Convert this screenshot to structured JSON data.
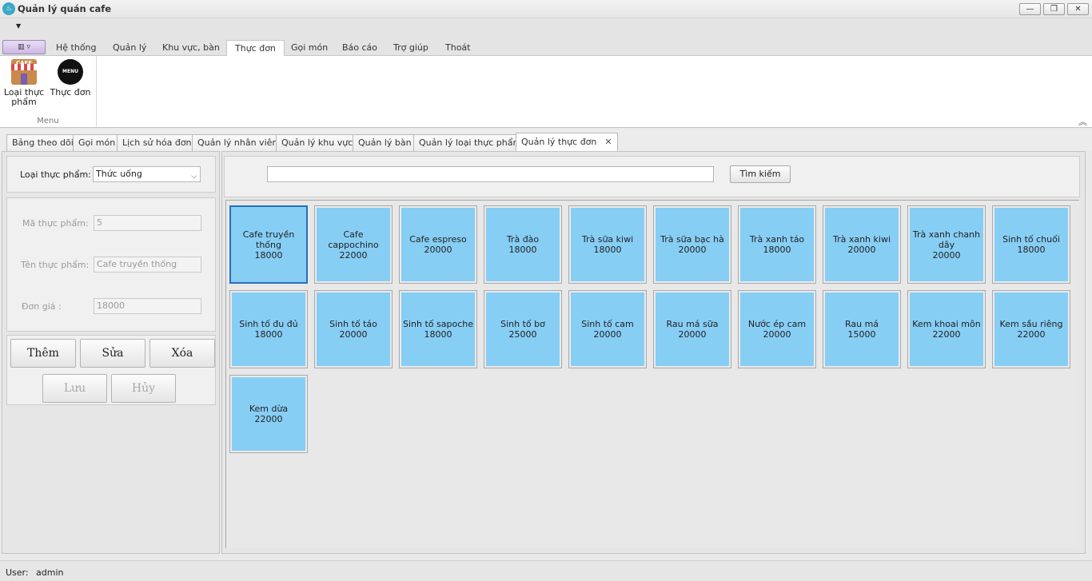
{
  "window": {
    "title": "Quản lý quán cafe",
    "controls": {
      "minimize": "—",
      "restore": "❐",
      "close": "✕"
    }
  },
  "ribbon": {
    "tabs": [
      "Hệ thống",
      "Quản lý",
      "Khu vực, bàn",
      "Thực đơn",
      "Gọi món",
      "Báo cáo",
      "Trợ giúp",
      "Thoát"
    ],
    "active_tab": "Thực đơn",
    "group": {
      "label": "Menu",
      "buttons": [
        {
          "label": "Loại thực phẩm",
          "icon": "cafe-shop-icon"
        },
        {
          "label": "Thực đơn",
          "icon": "menu-badge-icon"
        }
      ]
    },
    "icon_texts": {
      "cafe": "CAFE",
      "menu": "MENU"
    }
  },
  "doc_tabs": [
    "Bảng theo dõi",
    "Gọi món",
    "Lịch sử hóa đơn",
    "Quản lý nhân viên",
    "Quản lý khu vực",
    "Quản lý bàn",
    "Quản lý loại thực phẩm",
    "Quản lý thực đơn"
  ],
  "active_doc_tab": "Quản lý thực đơn",
  "form": {
    "category_label": "Loại thực phẩm:",
    "category_value": "Thức uống",
    "code_label": "Mã thực phẩm:",
    "code_value": "5",
    "name_label": "Tên thực phẩm:",
    "name_value": "Cafe truyền thống",
    "price_label": "Đơn giá :",
    "price_value": "18000"
  },
  "buttons": {
    "add": "Thêm",
    "edit": "Sửa",
    "delete": "Xóa",
    "save": "Lưu",
    "cancel": "Hủy"
  },
  "search": {
    "value": "",
    "button": "Tìm kiếm"
  },
  "menu_items": [
    {
      "name": "Cafe truyền thống",
      "price": "18000",
      "selected": true
    },
    {
      "name": "Cafe cappochino",
      "price": "22000"
    },
    {
      "name": "Cafe espreso",
      "price": "20000"
    },
    {
      "name": "Trà đào",
      "price": "18000"
    },
    {
      "name": "Trà sữa kiwi",
      "price": "18000"
    },
    {
      "name": "Trà sữa bạc hà",
      "price": "20000"
    },
    {
      "name": "Trà xanh táo",
      "price": "18000"
    },
    {
      "name": "Trà xanh kiwi",
      "price": "20000"
    },
    {
      "name": "Trà xanh chanh dây",
      "price": "20000"
    },
    {
      "name": "Sinh tố chuối",
      "price": "18000"
    },
    {
      "name": "Sinh tố đu đủ",
      "price": "18000"
    },
    {
      "name": "Sinh tố táo",
      "price": "20000"
    },
    {
      "name": "Sinh tố sapoche",
      "price": "18000"
    },
    {
      "name": "Sinh tố bơ",
      "price": "25000"
    },
    {
      "name": "Sinh tố cam",
      "price": "20000"
    },
    {
      "name": "Rau má sữa",
      "price": "20000"
    },
    {
      "name": "Nước ép cam",
      "price": "20000"
    },
    {
      "name": "Rau má",
      "price": "15000"
    },
    {
      "name": "Kem khoai môn",
      "price": "22000"
    },
    {
      "name": "Kem sầu riêng",
      "price": "22000"
    },
    {
      "name": "Kem dừa",
      "price": "22000"
    }
  ],
  "status": {
    "user_label": "User:",
    "user_value": "admin"
  },
  "colors": {
    "tile": "#87cef5",
    "selected_border": "#2a6fb8"
  }
}
